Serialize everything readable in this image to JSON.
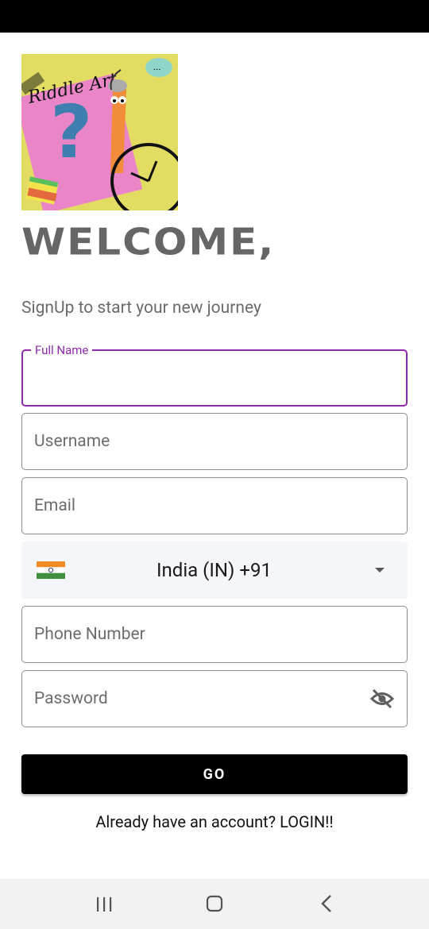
{
  "header": {
    "logo_alt": "Riddle Art",
    "welcome": "WELCOME,",
    "subtitle": "SignUp to start your new journey"
  },
  "form": {
    "full_name": {
      "label": "Full Name",
      "value": ""
    },
    "username": {
      "placeholder": "Username"
    },
    "email": {
      "placeholder": "Email"
    },
    "country": {
      "text": "India (IN)  +91",
      "flag_icon": "india-flag-icon"
    },
    "phone": {
      "placeholder": "Phone Number"
    },
    "password": {
      "placeholder": "Password",
      "toggle_icon": "visibility-off-icon"
    }
  },
  "actions": {
    "go_label": "GO",
    "login_text": "Already have an account? LOGIN!!"
  },
  "colors": {
    "accent": "#8e2aa8",
    "button": "#000000",
    "logo_bg": "#e3dc62"
  },
  "navbar": {
    "icons": [
      "recents-icon",
      "home-icon",
      "back-icon"
    ]
  }
}
